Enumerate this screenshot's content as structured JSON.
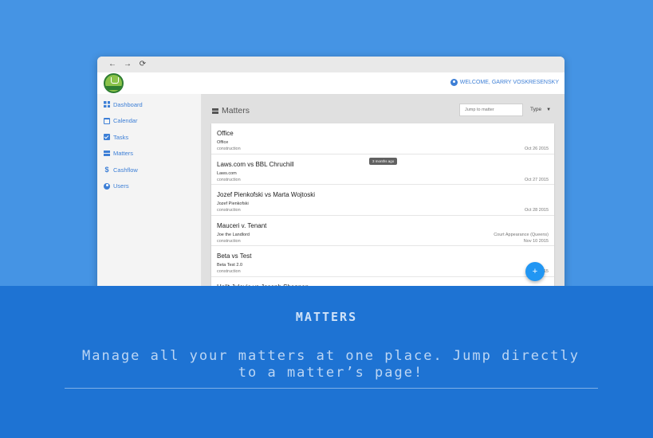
{
  "browser": {
    "back_icon": "←",
    "forward_icon": "→",
    "reload_icon": "⟳"
  },
  "header": {
    "welcome": "WELCOME, GARRY VOSKRESENSKY"
  },
  "sidebar": {
    "items": [
      {
        "label": "Dashboard",
        "icon": "dashboard-icon"
      },
      {
        "label": "Calendar",
        "icon": "calendar-icon"
      },
      {
        "label": "Tasks",
        "icon": "tasks-icon"
      },
      {
        "label": "Matters",
        "icon": "matters-icon"
      },
      {
        "label": "Cashflow",
        "icon": "dollar-icon"
      },
      {
        "label": "Users",
        "icon": "users-icon"
      }
    ]
  },
  "main": {
    "title": "Matters",
    "jump_placeholder": "Jump to matter",
    "type_label": "Type",
    "tooltip": "3 months ago",
    "fab_label": "+",
    "matters": [
      {
        "title": "Office",
        "client": "Office",
        "type": "construction",
        "event": "",
        "date": "Oct 26 2015"
      },
      {
        "title": "Laws.com vs BBL Chruchill",
        "client": "Laws.com",
        "type": "construction",
        "event": "",
        "date": "Oct 27 2015"
      },
      {
        "title": "Jozef Pienkofski vs Marta Wojtoski",
        "client": "Jozef Pienkofski",
        "type": "construction",
        "event": "",
        "date": "Oct 28 2015"
      },
      {
        "title": "Mauceri v. Tenant",
        "client": "Joe the Landlord",
        "type": "construction",
        "event": "Court Appearance (Queens)",
        "date": "Nov 10 2015"
      },
      {
        "title": "Beta vs Test",
        "client": "Beta Test 2.0",
        "type": "construction",
        "event": "",
        "date": "Dec 4 2015"
      },
      {
        "title": "Halit Julevic vs Joseph Shannon",
        "client": "",
        "type": "",
        "event": "",
        "date": ""
      }
    ]
  },
  "caption": {
    "title": "MATTERS",
    "text": "Manage all your matters at one place. Jump directly to a matter’s page!"
  }
}
